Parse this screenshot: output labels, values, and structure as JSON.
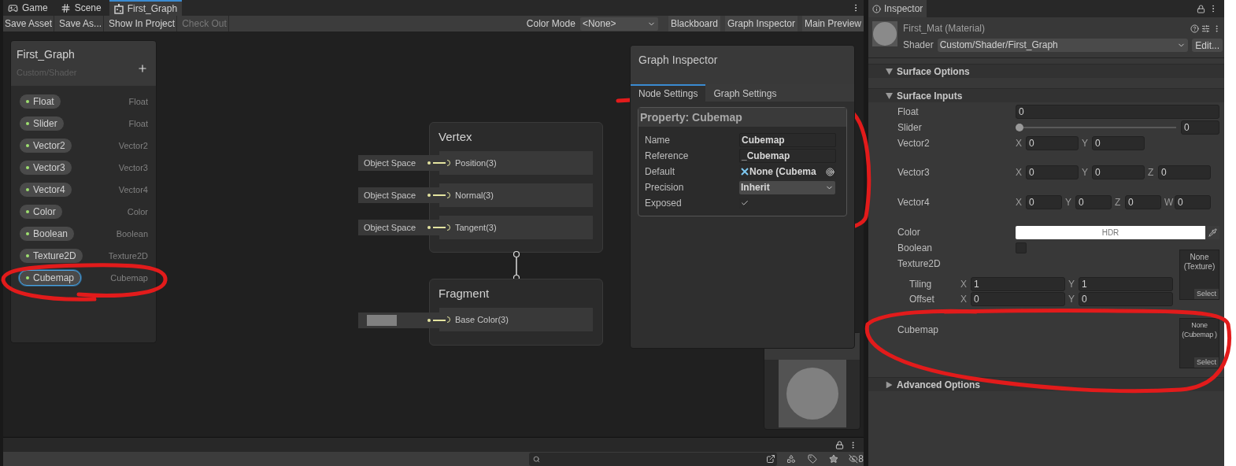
{
  "editor_tabs": [
    {
      "label": "Game",
      "kind": "game",
      "selected": false
    },
    {
      "label": "Scene",
      "kind": "scene",
      "selected": false
    },
    {
      "label": "First_Graph",
      "kind": "graph",
      "selected": true
    }
  ],
  "toolbar": {
    "buttons": [
      {
        "label": "Save Asset",
        "disabled": false
      },
      {
        "label": "Save As...",
        "disabled": false
      },
      {
        "label": "Show In Project",
        "disabled": false
      },
      {
        "label": "Check Out",
        "disabled": true
      }
    ],
    "color_mode_label": "Color Mode",
    "color_mode_value": "<None>",
    "toggles": [
      "Blackboard",
      "Graph Inspector",
      "Main Preview"
    ]
  },
  "blackboard": {
    "title": "First_Graph",
    "subtitle": "Custom/Shader",
    "properties": [
      {
        "name": "Float",
        "type": "Float",
        "selected": false
      },
      {
        "name": "Slider",
        "type": "Float",
        "selected": false
      },
      {
        "name": "Vector2",
        "type": "Vector2",
        "selected": false
      },
      {
        "name": "Vector3",
        "type": "Vector3",
        "selected": false
      },
      {
        "name": "Vector4",
        "type": "Vector4",
        "selected": false
      },
      {
        "name": "Color",
        "type": "Color",
        "selected": false
      },
      {
        "name": "Boolean",
        "type": "Boolean",
        "selected": false
      },
      {
        "name": "Texture2D",
        "type": "Texture2D",
        "selected": false
      },
      {
        "name": "Cubemap",
        "type": "Cubemap",
        "selected": true
      }
    ]
  },
  "vertex_node": {
    "title": "Vertex",
    "ports": [
      {
        "label": "Position(3)",
        "kind": "space",
        "input": "Object Space"
      },
      {
        "label": "Normal(3)",
        "kind": "space",
        "input": "Object Space"
      },
      {
        "label": "Tangent(3)",
        "kind": "space",
        "input": "Object Space"
      }
    ]
  },
  "fragment_node": {
    "title": "Fragment",
    "ports": [
      {
        "label": "Base Color(3)",
        "kind": "swatch"
      }
    ]
  },
  "graph_inspector": {
    "title": "Graph Inspector",
    "tabs": [
      {
        "label": "Node Settings",
        "selected": true
      },
      {
        "label": "Graph Settings",
        "selected": false
      }
    ],
    "section_title": "Property: Cubemap",
    "fields": [
      {
        "label": "Name",
        "kind": "text",
        "value": "Cubemap"
      },
      {
        "label": "Reference",
        "kind": "text",
        "value": "_Cubemap"
      },
      {
        "label": "Default",
        "kind": "object",
        "value": "None (Cubema"
      },
      {
        "label": "Precision",
        "kind": "dropdown",
        "value": "Inherit"
      },
      {
        "label": "Exposed",
        "kind": "checkbox",
        "checked": true
      }
    ]
  },
  "status_bar": {
    "hidden_count": "8"
  },
  "inspector": {
    "tab": "Inspector",
    "material": "First_Mat (Material)",
    "shader_label": "Shader",
    "shader_value": "Custom/Shader/First_Graph",
    "edit_button": "Edit...",
    "sections": [
      {
        "title": "Surface Options",
        "expanded": true
      },
      {
        "title": "Surface Inputs",
        "expanded": true,
        "rows": [
          {
            "label": "Float",
            "kind": "number",
            "value": "0"
          },
          {
            "label": "Slider",
            "kind": "slider",
            "level": 0,
            "value": "0"
          },
          {
            "label": "Vector2",
            "kind": "vector",
            "components": [
              {
                "axis": "X",
                "value": "0"
              },
              {
                "axis": "Y",
                "value": "0"
              }
            ]
          },
          {
            "label": "Vector3",
            "kind": "vector",
            "components": [
              {
                "axis": "X",
                "value": "0"
              },
              {
                "axis": "Y",
                "value": "0"
              },
              {
                "axis": "Z",
                "value": "0"
              }
            ]
          },
          {
            "label": "Vector4",
            "kind": "vector",
            "components": [
              {
                "axis": "X",
                "value": "0"
              },
              {
                "axis": "Y",
                "value": "0"
              },
              {
                "axis": "Z",
                "value": "0"
              },
              {
                "axis": "W",
                "value": "0"
              }
            ]
          },
          {
            "label": "Color",
            "kind": "color",
            "value": "HDR"
          },
          {
            "label": "Boolean",
            "kind": "checkbox",
            "checked": false
          },
          {
            "label": "Texture2D",
            "kind": "texture",
            "slot": "None (Texture)",
            "select": "Select",
            "tiling": {
              "label": "Tiling",
              "components": [
                {
                  "axis": "X",
                  "value": "1"
                },
                {
                  "axis": "Y",
                  "value": "1"
                }
              ]
            },
            "offset": {
              "label": "Offset",
              "components": [
                {
                  "axis": "X",
                  "value": "0"
                },
                {
                  "axis": "Y",
                  "value": "0"
                }
              ]
            }
          },
          {
            "label": "Cubemap",
            "kind": "cubemap",
            "slot": "None (Cubemap )",
            "select": "Select"
          }
        ]
      },
      {
        "title": "Advanced Options",
        "expanded": false
      }
    ]
  }
}
